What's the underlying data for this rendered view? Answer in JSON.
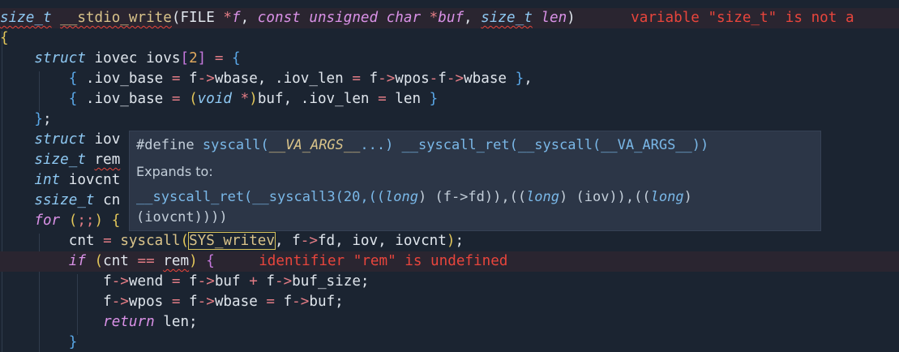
{
  "editor": {
    "lines": [
      {
        "segs": [
          [
            "size_t",
            "ty squig"
          ],
          [
            " ",
            "t"
          ],
          [
            "__stdio_write",
            "fn squig"
          ],
          [
            "(",
            "t"
          ],
          [
            "FILE",
            "t"
          ],
          [
            " ",
            "t"
          ],
          [
            "*",
            "op"
          ],
          [
            "f",
            "pm"
          ],
          [
            ", ",
            "t"
          ],
          [
            "const",
            "kw"
          ],
          [
            " ",
            "t"
          ],
          [
            "unsigned",
            "kw"
          ],
          [
            " ",
            "t"
          ],
          [
            "char",
            "kw"
          ],
          [
            " ",
            "t"
          ],
          [
            "*",
            "op"
          ],
          [
            "buf",
            "pm"
          ],
          [
            ", ",
            "t"
          ],
          [
            "size_t",
            "ty squig"
          ],
          [
            " ",
            "t"
          ],
          [
            "len",
            "pm"
          ],
          [
            ")",
            "t"
          ]
        ],
        "diag": "variable \"size_t\" is not a"
      },
      {
        "segs": [
          [
            "{",
            "brg"
          ]
        ]
      },
      {
        "segs": [
          [
            "    ",
            "t"
          ],
          [
            "struct",
            "ty"
          ],
          [
            " iovec iovs",
            "t"
          ],
          [
            "[",
            "brm"
          ],
          [
            "2",
            "num"
          ],
          [
            "]",
            "brm"
          ],
          [
            " ",
            "t"
          ],
          [
            "=",
            "op"
          ],
          [
            " ",
            "t"
          ],
          [
            "{",
            "br"
          ]
        ]
      },
      {
        "segs": [
          [
            "        ",
            "t"
          ],
          [
            "{",
            "br"
          ],
          [
            " .iov_base ",
            "t"
          ],
          [
            "=",
            "op"
          ],
          [
            " f",
            "t"
          ],
          [
            "->",
            "op"
          ],
          [
            "wbase, .iov_len ",
            "t"
          ],
          [
            "=",
            "op"
          ],
          [
            " f",
            "t"
          ],
          [
            "->",
            "op"
          ],
          [
            "wpos",
            "t"
          ],
          [
            "-",
            "op"
          ],
          [
            "f",
            "t"
          ],
          [
            "->",
            "op"
          ],
          [
            "wbase ",
            "t"
          ],
          [
            "}",
            "br"
          ],
          [
            ",",
            "t"
          ]
        ]
      },
      {
        "segs": [
          [
            "        ",
            "t"
          ],
          [
            "{",
            "br"
          ],
          [
            " .iov_base ",
            "t"
          ],
          [
            "=",
            "op"
          ],
          [
            " ",
            "t"
          ],
          [
            "(",
            "brg"
          ],
          [
            "void",
            "ty"
          ],
          [
            " ",
            "t"
          ],
          [
            "*",
            "op"
          ],
          [
            ")",
            "brg"
          ],
          [
            "buf, .iov_len ",
            "t"
          ],
          [
            "=",
            "op"
          ],
          [
            " len ",
            "t"
          ],
          [
            "}",
            "br"
          ]
        ]
      },
      {
        "segs": [
          [
            "    ",
            "t"
          ],
          [
            "}",
            "br"
          ],
          [
            ";",
            "t"
          ]
        ]
      },
      {
        "segs": [
          [
            "    ",
            "t"
          ],
          [
            "struct",
            "ty"
          ],
          [
            " iov",
            "t"
          ]
        ]
      },
      {
        "segs": [
          [
            "    ",
            "t"
          ],
          [
            "size_t",
            "ty"
          ],
          [
            " ",
            "t"
          ],
          [
            "rem",
            "t squig"
          ]
        ]
      },
      {
        "segs": [
          [
            "    ",
            "t"
          ],
          [
            "int",
            "ty"
          ],
          [
            " iovcnt",
            "t"
          ]
        ]
      },
      {
        "segs": [
          [
            "    ",
            "t"
          ],
          [
            "ssize_t",
            "ty"
          ],
          [
            " cn",
            "t"
          ]
        ]
      },
      {
        "segs": [
          [
            "    ",
            "t"
          ],
          [
            "for",
            "kw"
          ],
          [
            " ",
            "t"
          ],
          [
            "(",
            "brg"
          ],
          [
            ";;",
            "op"
          ],
          [
            ")",
            "brg"
          ],
          [
            " ",
            "t"
          ],
          [
            "{",
            "brg"
          ]
        ]
      },
      {
        "segs": [
          [
            "        ",
            "t"
          ],
          [
            "cnt ",
            "t"
          ],
          [
            "=",
            "op"
          ],
          [
            " ",
            "t"
          ],
          [
            "syscall",
            "fn"
          ],
          [
            "(",
            "brg"
          ],
          [
            "SYS_writev",
            "fnbox"
          ],
          [
            ", f",
            "t"
          ],
          [
            "->",
            "op"
          ],
          [
            "fd, iov, iovcnt",
            "t"
          ],
          [
            ")",
            "brg"
          ],
          [
            ";",
            "t"
          ]
        ]
      },
      {
        "segs": [
          [
            "        ",
            "t"
          ],
          [
            "if",
            "kw"
          ],
          [
            " ",
            "t"
          ],
          [
            "(",
            "brg"
          ],
          [
            "cnt ",
            "t"
          ],
          [
            "==",
            "op"
          ],
          [
            " ",
            "t"
          ],
          [
            "rem",
            "t squig"
          ],
          [
            ")",
            "brg"
          ],
          [
            " ",
            "t"
          ],
          [
            "{",
            "brm"
          ]
        ],
        "diag": "identifier \"rem\" is undefined"
      },
      {
        "segs": [
          [
            "            ",
            "t"
          ],
          [
            "f",
            "t"
          ],
          [
            "->",
            "op"
          ],
          [
            "wend ",
            "t"
          ],
          [
            "=",
            "op"
          ],
          [
            " f",
            "t"
          ],
          [
            "->",
            "op"
          ],
          [
            "buf ",
            "t"
          ],
          [
            "+",
            "op"
          ],
          [
            " f",
            "t"
          ],
          [
            "->",
            "op"
          ],
          [
            "buf_size;",
            "t"
          ]
        ]
      },
      {
        "segs": [
          [
            "            ",
            "t"
          ],
          [
            "f",
            "t"
          ],
          [
            "->",
            "op"
          ],
          [
            "wpos ",
            "t"
          ],
          [
            "=",
            "op"
          ],
          [
            " f",
            "t"
          ],
          [
            "->",
            "op"
          ],
          [
            "wbase ",
            "t"
          ],
          [
            "=",
            "op"
          ],
          [
            " f",
            "t"
          ],
          [
            "->",
            "op"
          ],
          [
            "buf;",
            "t"
          ]
        ]
      },
      {
        "segs": [
          [
            "            ",
            "t"
          ],
          [
            "return",
            "kw"
          ],
          [
            " len;",
            "t"
          ]
        ]
      },
      {
        "segs": [
          [
            "        ",
            "t"
          ],
          [
            "}",
            "br"
          ]
        ]
      }
    ]
  },
  "hover": {
    "define_kw": "#define",
    "macro_sig": " syscall(",
    "macro_args": "__VA_ARGS__",
    "macro_rest": "...) __syscall_ret(__syscall(__VA_ARGS__))",
    "expands_label": "Expands to:",
    "exp1_a": "__syscall_ret(__syscall3(20,((",
    "exp1_long1": "long",
    "exp1_b": ") (f->fd)),((",
    "exp1_long2": "long",
    "exp1_c": ") (iov)),((",
    "exp1_long3": "long",
    "exp1_d": ")",
    "exp2": "(iovcnt))))"
  },
  "colors": {
    "background": "#1b2431",
    "error": "#e8453c",
    "hover_bg": "#2c3647"
  }
}
